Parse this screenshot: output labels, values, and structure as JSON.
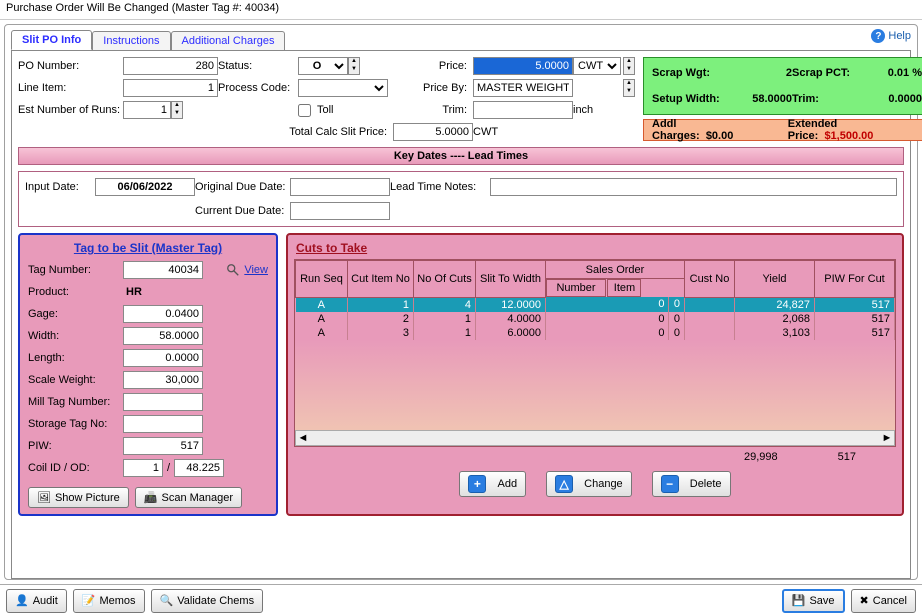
{
  "window": {
    "title": "Purchase Order Will Be Changed  (Master Tag #: 40034)"
  },
  "header": {
    "help": "Help"
  },
  "tabs": [
    "Slit PO Info",
    "Instructions",
    "Additional Charges"
  ],
  "po": {
    "po_number_label": "PO Number:",
    "po_number": "280",
    "line_item_label": "Line Item:",
    "line_item": "1",
    "est_runs_label": "Est Number of Runs:",
    "est_runs": "1",
    "status_label": "Status:",
    "status": "O",
    "process_code_label": "Process Code:",
    "toll_label": "Toll",
    "price_label": "Price:",
    "price": "5.0000",
    "price_unit": "CWT",
    "price_by_label": "Price By:",
    "price_by": "MASTER WEIGHT",
    "trim_label": "Trim:",
    "trim_unit": "inch",
    "total_calc_label": "Total Calc Slit Price:",
    "total_calc": "5.0000",
    "total_calc_unit": "CWT"
  },
  "summary": {
    "scrap_wgt_label": "Scrap Wgt:",
    "scrap_wgt": "2",
    "scrap_pct_label": "Scrap PCT:",
    "scrap_pct": "0.01 %",
    "setup_width_label": "Setup Width:",
    "setup_width": "58.0000",
    "trim_sum_label": "Trim:",
    "trim_sum": "0.0000",
    "addl_charges_label": "Addl Charges:",
    "addl_charges": "$0.00",
    "ext_price_label": "Extended Price:",
    "ext_price": "$1,500.00"
  },
  "dates": {
    "header": "Key Dates ---- Lead Times",
    "input_date_label": "Input Date:",
    "input_date": "06/06/2022",
    "original_due_label": "Original Due Date:",
    "current_due_label": "Current Due Date:",
    "lead_notes_label": "Lead Time Notes:"
  },
  "tag": {
    "title": "Tag to be Slit (Master Tag)",
    "tag_number_label": "Tag Number:",
    "tag_number": "40034",
    "view_label": "View",
    "product_label": "Product:",
    "product": "HR",
    "gage_label": "Gage:",
    "gage": "0.0400",
    "width_label": "Width:",
    "width": "58.0000",
    "length_label": "Length:",
    "length": "0.0000",
    "scale_weight_label": "Scale Weight:",
    "scale_weight": "30,000",
    "mill_tag_label": "Mill Tag Number:",
    "storage_tag_label": "Storage Tag No:",
    "piw_label": "PIW:",
    "piw": "517",
    "coil_label": "Coil ID / OD:",
    "coil_id": "1",
    "coil_od": "48.225",
    "show_picture_label": "Show Picture",
    "scan_manager_label": "Scan Manager"
  },
  "cuts": {
    "title": "Cuts to Take",
    "columns": [
      "Run Seq",
      "Cut Item No",
      "No Of Cuts",
      "Slit To Width",
      "Sales Order",
      "Cust No",
      "Yield",
      "PIW For Cut"
    ],
    "subcolumns": [
      "Number",
      "Item"
    ],
    "rows": [
      {
        "runseq": "A",
        "itemno": "1",
        "nocuts": "4",
        "width": "12.0000",
        "so_num": "0",
        "so_item": "0",
        "cust": "",
        "yield": "24,827",
        "piw": "517",
        "selected": true
      },
      {
        "runseq": "A",
        "itemno": "2",
        "nocuts": "1",
        "width": "4.0000",
        "so_num": "0",
        "so_item": "0",
        "cust": "",
        "yield": "2,068",
        "piw": "517",
        "selected": false
      },
      {
        "runseq": "A",
        "itemno": "3",
        "nocuts": "1",
        "width": "6.0000",
        "so_num": "0",
        "so_item": "0",
        "cust": "",
        "yield": "3,103",
        "piw": "517",
        "selected": false
      }
    ],
    "totals": {
      "yield": "29,998",
      "piw": "517"
    },
    "add_label": "Add",
    "change_label": "Change",
    "delete_label": "Delete"
  },
  "footer": {
    "audit": "Audit",
    "memos": "Memos",
    "validate": "Validate\nChems",
    "save": "Save",
    "cancel": "Cancel"
  }
}
